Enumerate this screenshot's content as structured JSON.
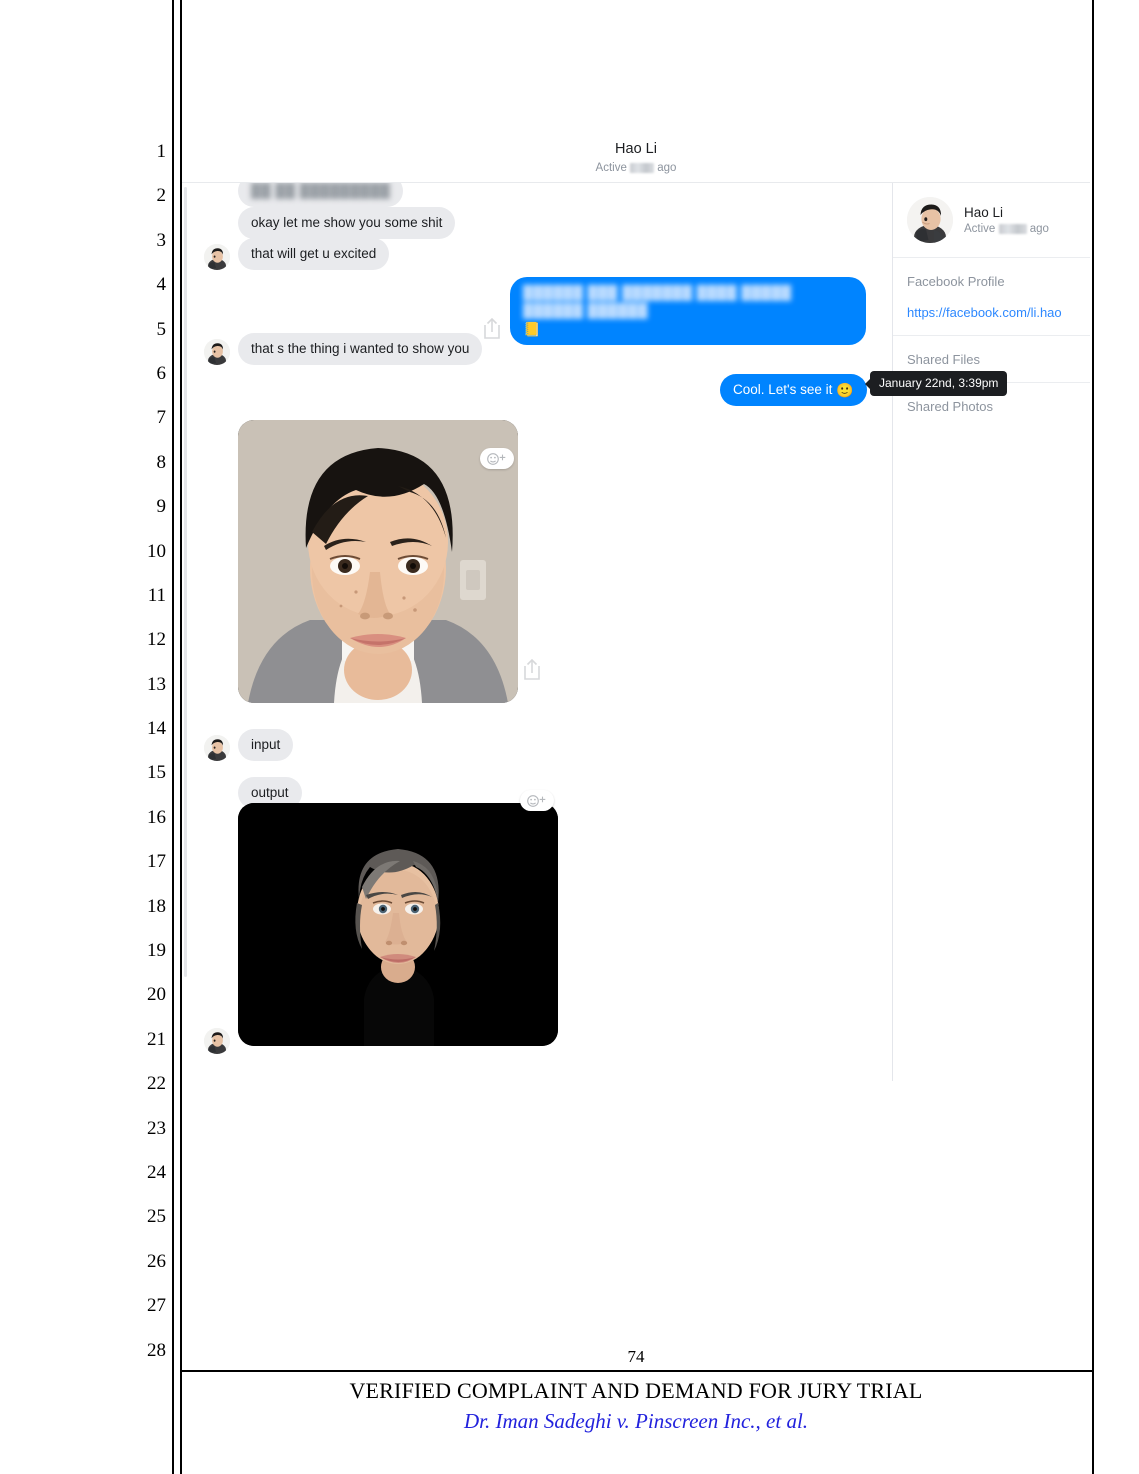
{
  "document": {
    "page_number": "74",
    "footer_title": "VERIFIED COMPLAINT AND DEMAND FOR JURY TRIAL",
    "footer_caption": "Dr. Iman Sadeghi v. Pinscreen Inc., et al.",
    "line_numbers": [
      "1",
      "2",
      "3",
      "4",
      "5",
      "6",
      "7",
      "8",
      "9",
      "10",
      "11",
      "12",
      "13",
      "14",
      "15",
      "16",
      "17",
      "18",
      "19",
      "20",
      "21",
      "22",
      "23",
      "24",
      "25",
      "26",
      "27",
      "28"
    ]
  },
  "messenger": {
    "header": {
      "title": "Hao Li",
      "active_prefix": "Active",
      "active_redacted": "███",
      "active_suffix": "ago"
    },
    "messages": [
      {
        "id": "msg-redacted-top",
        "sender": "them",
        "text": "██ ██ █████████",
        "redacted": true
      },
      {
        "id": "msg-okay-let-me-show",
        "sender": "them",
        "text": "okay let me show you some shit",
        "redacted": false
      },
      {
        "id": "msg-that-will-get-u-excited",
        "sender": "them",
        "text": "that will get u excited",
        "redacted": false
      },
      {
        "id": "msg-redacted-blue",
        "sender": "me",
        "text": "██████ ███ ███████ ████ █████ ██████ ██████",
        "emoji": "📒",
        "redacted": true
      },
      {
        "id": "msg-that-s-the-thing",
        "sender": "them",
        "text": "that s the thing i wanted to show you",
        "redacted": false
      },
      {
        "id": "msg-cool-lets-see-it",
        "sender": "me",
        "text": "Cool. Let's see it",
        "emoji": "🙂",
        "redacted": false
      },
      {
        "id": "msg-input",
        "sender": "them",
        "text": "input",
        "redacted": false
      },
      {
        "id": "msg-output",
        "sender": "them",
        "text": "output",
        "redacted": false
      }
    ],
    "attachments": [
      {
        "id": "attachment-input-photo",
        "kind": "photo",
        "caption": "input"
      },
      {
        "id": "attachment-output-render",
        "kind": "render",
        "caption": "output"
      }
    ],
    "tooltip": {
      "text": "January 22nd, 3:39pm"
    },
    "details_panel": {
      "name": "Hao Li",
      "active_prefix": "Active",
      "active_redacted": "████",
      "active_suffix": "ago",
      "facebook_profile_label": "Facebook Profile",
      "facebook_url": "https://facebook.com/li.hao",
      "shared_files_label": "Shared Files",
      "shared_photos_label": "Shared Photos"
    },
    "icons": {
      "share": "share-icon",
      "add_reaction": "add-reaction-icon"
    },
    "colors": {
      "outgoing_bubble": "#0084ff",
      "incoming_bubble": "#e9eaed",
      "link": "#2d88ff",
      "tooltip_bg": "#1c1e21",
      "caption_blue": "#2222dd"
    }
  }
}
